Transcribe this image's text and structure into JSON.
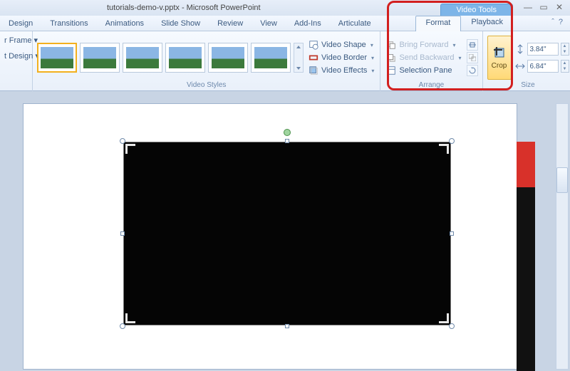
{
  "title": "tutorials-demo-v.pptx - Microsoft PowerPoint",
  "context_tool": "Video Tools",
  "tabs": {
    "design": "Design",
    "transitions": "Transitions",
    "animations": "Animations",
    "slideshow": "Slide Show",
    "review": "Review",
    "view": "View",
    "addins": "Add-Ins",
    "articulate": "Articulate"
  },
  "ctx_tabs": {
    "format": "Format",
    "playback": "Playback"
  },
  "left_truncated": {
    "frame": "r Frame ▾",
    "design": "t Design ▾"
  },
  "styles_group": "Video Styles",
  "sbe": {
    "shape": "Video Shape",
    "border": "Video Border",
    "effects": "Video Effects"
  },
  "arrange": {
    "group": "Arrange",
    "forward": "Bring Forward",
    "backward": "Send Backward",
    "selection": "Selection Pane"
  },
  "crop": "Crop",
  "size": {
    "group": "Size",
    "h": "3.84\"",
    "w": "6.84\""
  }
}
